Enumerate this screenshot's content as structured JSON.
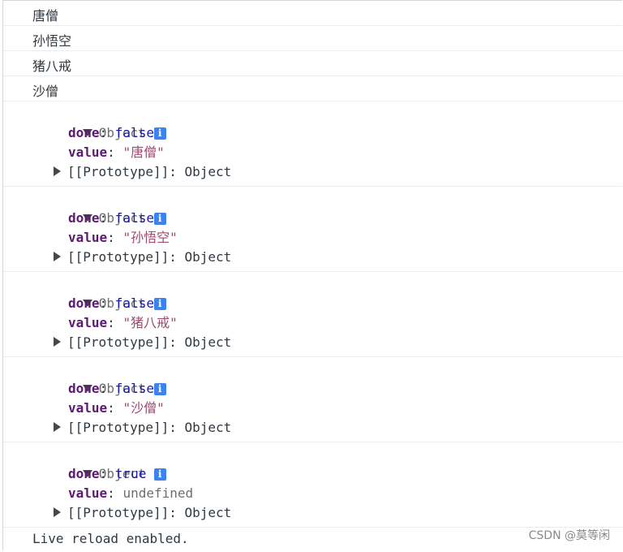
{
  "text_logs": [
    "唐僧",
    "孙悟空",
    "猪八戒",
    "沙僧"
  ],
  "objects": [
    {
      "label": "Object",
      "done_key": "done",
      "done_value": "false",
      "value_key": "value",
      "value_display": "\"唐僧\"",
      "proto_key": "[[Prototype]]",
      "proto_value": "Object"
    },
    {
      "label": "Object",
      "done_key": "done",
      "done_value": "false",
      "value_key": "value",
      "value_display": "\"孙悟空\"",
      "proto_key": "[[Prototype]]",
      "proto_value": "Object"
    },
    {
      "label": "Object",
      "done_key": "done",
      "done_value": "false",
      "value_key": "value",
      "value_display": "\"猪八戒\"",
      "proto_key": "[[Prototype]]",
      "proto_value": "Object"
    },
    {
      "label": "Object",
      "done_key": "done",
      "done_value": "false",
      "value_key": "value",
      "value_display": "\"沙僧\"",
      "proto_key": "[[Prototype]]",
      "proto_value": "Object"
    },
    {
      "label": "Object",
      "done_key": "done",
      "done_value": "true",
      "value_key": "value",
      "value_display": "undefined",
      "proto_key": "[[Prototype]]",
      "proto_value": "Object"
    }
  ],
  "info_icon": "i",
  "live_reload": "Live reload enabled.",
  "watermark": "CSDN @莫等闲"
}
